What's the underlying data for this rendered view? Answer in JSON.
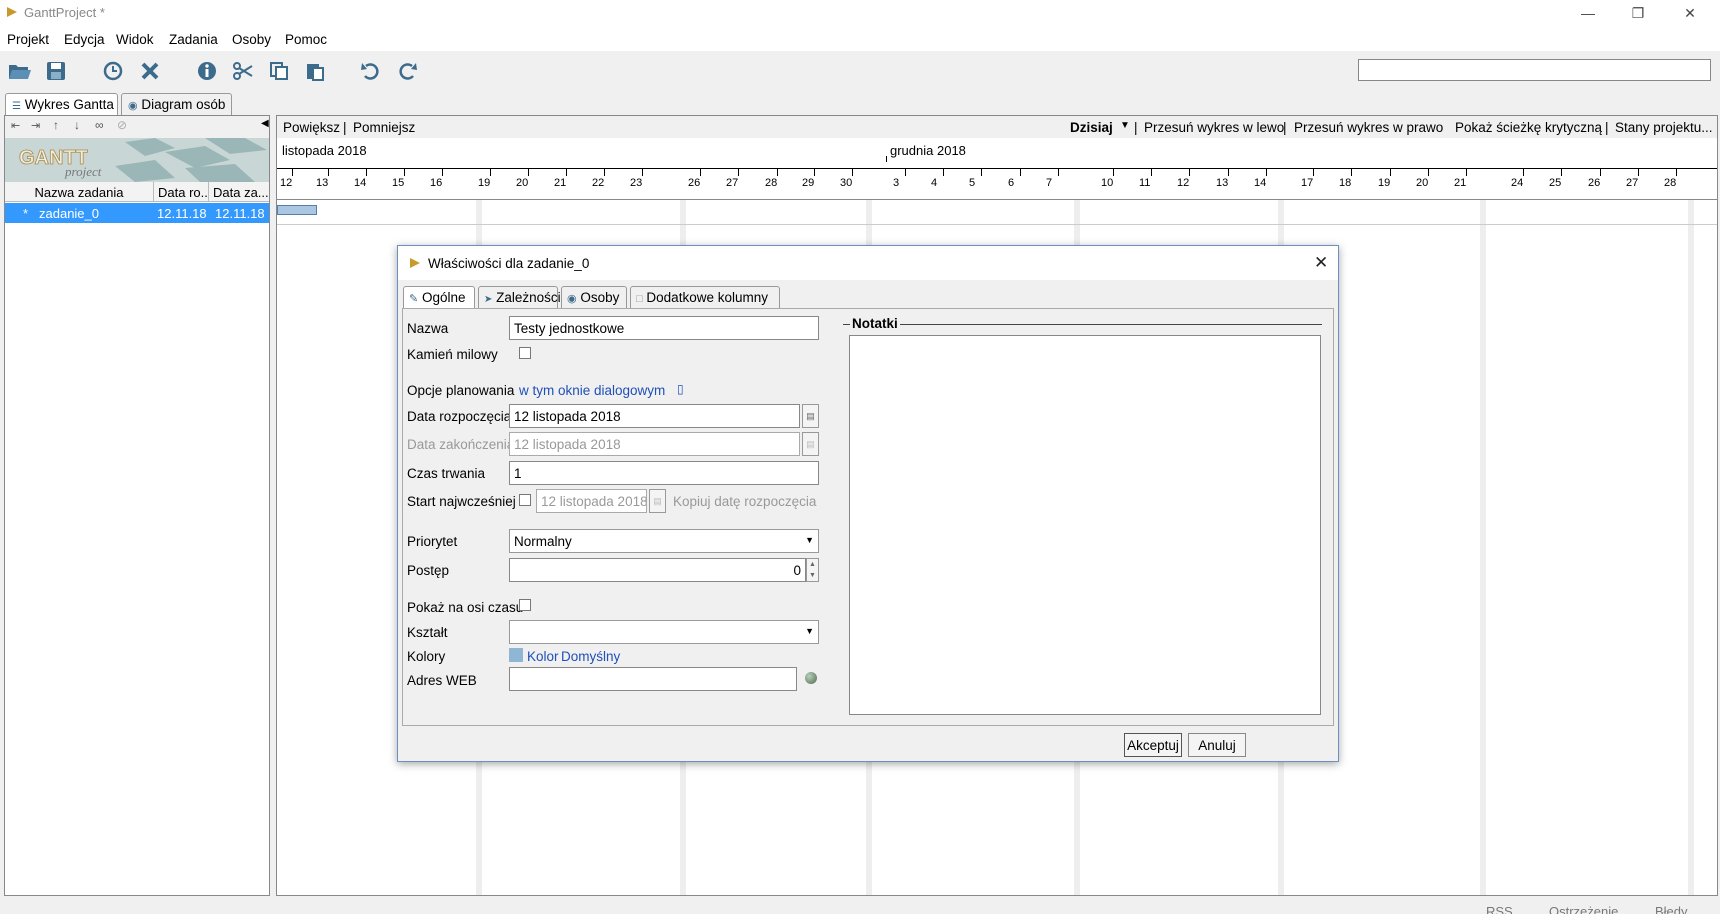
{
  "window": {
    "title": "GanttProject *"
  },
  "menu": [
    "Projekt",
    "Edycja",
    "Widok",
    "Zadania",
    "Osoby",
    "Pomoc"
  ],
  "toolbar": {
    "icons": [
      "open-icon",
      "save-icon",
      "history-icon",
      "delete-icon",
      "properties-icon",
      "cut-icon",
      "copy-icon",
      "paste-icon",
      "undo-icon",
      "redo-icon"
    ],
    "search_value": ""
  },
  "main_tabs": [
    {
      "label": "Wykres Gantta",
      "active": true
    },
    {
      "label": "Diagram osób",
      "active": false
    }
  ],
  "tree": {
    "columns": [
      "Nazwa zadania",
      "Data ro...",
      "Data za..."
    ],
    "rows": [
      {
        "name": "zadanie_0",
        "start": "12.11.18",
        "end": "12.11.18"
      }
    ]
  },
  "chart_toolbar": {
    "zoom_in": "Powiększ",
    "zoom_out": "Pomniejsz",
    "today": "Dzisiaj",
    "scroll_left": "Przesuń wykres w lewo",
    "scroll_right": "Przesuń wykres w prawo",
    "critical_path": "Pokaż ścieżkę krytyczną",
    "baselines": "Stany projektu..."
  },
  "timeline": {
    "months": [
      "listopada 2018",
      "grudnia 2018"
    ],
    "days": [
      "12",
      "13",
      "14",
      "15",
      "16",
      "19",
      "20",
      "21",
      "22",
      "23",
      "26",
      "27",
      "28",
      "29",
      "30",
      "3",
      "4",
      "5",
      "6",
      "7",
      "10",
      "11",
      "12",
      "13",
      "14",
      "17",
      "18",
      "19",
      "20",
      "21",
      "24",
      "25",
      "26",
      "27",
      "28"
    ]
  },
  "dialog": {
    "title": "Właściwości dla zadanie_0",
    "tabs": [
      "Ogólne",
      "Zależności",
      "Osoby",
      "Dodatkowe kolumny"
    ],
    "labels": {
      "name": "Nazwa",
      "milestone": "Kamień milowy",
      "scheduling": "Opcje planowania",
      "start_date": "Data rozpoczęcia",
      "end_date": "Data zakończenia",
      "duration": "Czas trwania",
      "earliest_start": "Start najwcześniej",
      "priority": "Priorytet",
      "progress": "Postęp",
      "show_timeline": "Pokaż na osi czasu",
      "shape": "Kształt",
      "colors": "Kolory",
      "web": "Adres WEB",
      "notes": "Notatki"
    },
    "values": {
      "name": "Testy jednostkowe",
      "scheduling_link": "w tym oknie dialogowym",
      "start_date": "12 listopada 2018",
      "end_date": "12 listopada 2018",
      "duration": "1",
      "earliest_start": "12 listopada 2018",
      "copy_start": "Kopiuj datę rozpoczęcia",
      "priority": "Normalny",
      "progress": "0",
      "shape": "",
      "color_link": "Kolor",
      "default_link": "Domyślny",
      "web": ""
    },
    "buttons": {
      "accept": "Akceptuj",
      "cancel": "Anuluj"
    }
  },
  "status": [
    "RSS",
    "Ostrzeżenie",
    "Błędy"
  ],
  "colors": {
    "selection": "#3399ff",
    "link": "#1f4fb8",
    "task_bar": "#a9c7e3"
  }
}
